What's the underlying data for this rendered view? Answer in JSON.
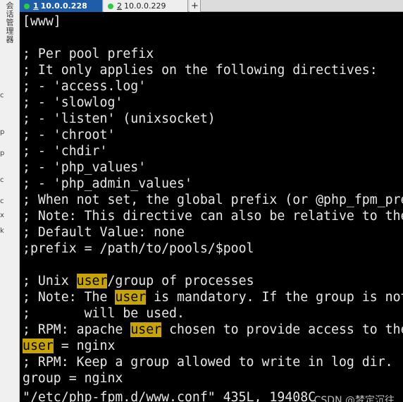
{
  "sidebar": {
    "vertical_text": "会话管理器",
    "marks": [
      "c",
      "p",
      "p",
      "c",
      "c",
      "x",
      "k"
    ]
  },
  "tabs": [
    {
      "number": "1",
      "label": "10.0.0.228",
      "status_color": "#2ecc40",
      "active": true
    },
    {
      "number": "2",
      "label": "10.0.0.229",
      "status_color": "#2ecc40",
      "active": false
    }
  ],
  "new_tab_symbol": "+",
  "terminal": {
    "lines": [
      {
        "text": "[www]"
      },
      {
        "text": ""
      },
      {
        "text": "; Per pool prefix"
      },
      {
        "text": "; It only applies on the following directives:"
      },
      {
        "text": "; - 'access.log'"
      },
      {
        "text": "; - 'slowlog'"
      },
      {
        "text": "; - 'listen' (unixsocket)"
      },
      {
        "text": "; - 'chroot'"
      },
      {
        "text": "; - 'chdir'"
      },
      {
        "text": "; - 'php_values'"
      },
      {
        "text": "; - 'php_admin_values'"
      },
      {
        "text": "; When not set, the global prefix (or @php_fpm_prefix@) applies instead."
      },
      {
        "text": "; Note: This directive can also be relative to the global prefix."
      },
      {
        "text": "; Default Value: none"
      },
      {
        "text": ";prefix = /path/to/pools/$pool"
      },
      {
        "text": ""
      },
      {
        "text": "; Unix ",
        "hl": "user",
        "after": "/group of processes"
      },
      {
        "text": "; Note: The ",
        "hl": "user",
        "after": " is mandatory. If the group is not set, the default user's group"
      },
      {
        "text": ";       will be used."
      },
      {
        "text": "; RPM: apache ",
        "hl": "user",
        "after": " chosen to provide access to the same directories as httpd"
      },
      {
        "text": "",
        "hl": "user",
        "after": " = nginx"
      },
      {
        "text": "; RPM: Keep a group allowed to write in log dir."
      },
      {
        "text": "group = nginx"
      }
    ],
    "status_line": "\"/etc/php-fpm.d/www.conf\" 435L, 19408C"
  },
  "watermark": "CSDN @梦定沉往",
  "colors": {
    "terminal_bg": "#000000",
    "terminal_fg": "#e8e8e8",
    "search_highlight_bg": "#c8a400",
    "active_tab_bg": "#1e5ea8"
  }
}
